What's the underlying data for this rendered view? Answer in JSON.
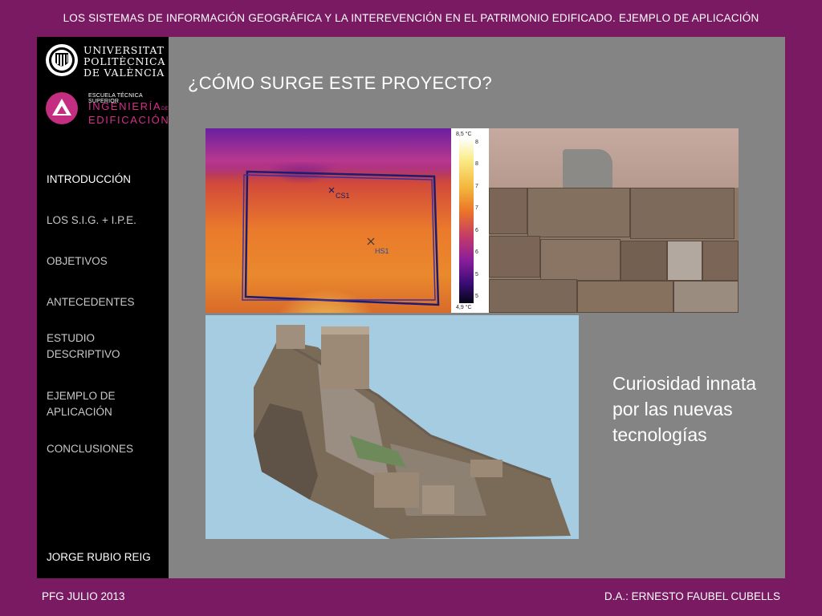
{
  "header": {
    "title": "LOS SISTEMAS DE INFORMACIÓN GEOGRÁFICA Y LA INTEREVENCIÓN EN EL PATRIMONIO EDIFICADO. EJEMPLO DE APLICACIÓN"
  },
  "sidebar": {
    "upv": {
      "line1": "UNIVERSITAT",
      "line2": "POLITÈCNICA",
      "line3": "DE VALÈNCIA"
    },
    "etsie": {
      "small": "ESCUELA TÉCNICA SUPERIOR",
      "line1": "INGENIERÍA",
      "de": "DE",
      "line2": "EDIFICACIÓN"
    },
    "items": [
      {
        "label": "INTRODUCCIÓN"
      },
      {
        "label": "LOS S.I.G. + I.P.E."
      },
      {
        "label": "OBJETIVOS"
      },
      {
        "label": "ANTECEDENTES"
      },
      {
        "label": "ESTUDIO DESCRIPTIVO"
      },
      {
        "label": "EJEMPLO DE APLICACIÓN"
      },
      {
        "label": "CONCLUSIONES"
      }
    ],
    "author": "JORGE RUBIO REIG"
  },
  "main": {
    "title": "¿CÓMO SURGE ESTE PROYECTO?",
    "thermal": {
      "max_label": "8,5 °C",
      "min_label": "4,9 °C",
      "spot1": "CS1",
      "spot2": "HS1",
      "ticks": [
        "8",
        "8",
        "7",
        "7",
        "6",
        "6",
        "5",
        "5"
      ]
    },
    "caption": "Curiosidad innata por las nuevas tecnologías"
  },
  "footer": {
    "left": "PFG JULIO 2013",
    "right": "D.A.: ERNESTO FAUBEL CUBELLS"
  },
  "colors": {
    "background": "#7a1a63",
    "panel": "#848484",
    "sidebar": "#000000",
    "accent": "#d62f8a"
  }
}
